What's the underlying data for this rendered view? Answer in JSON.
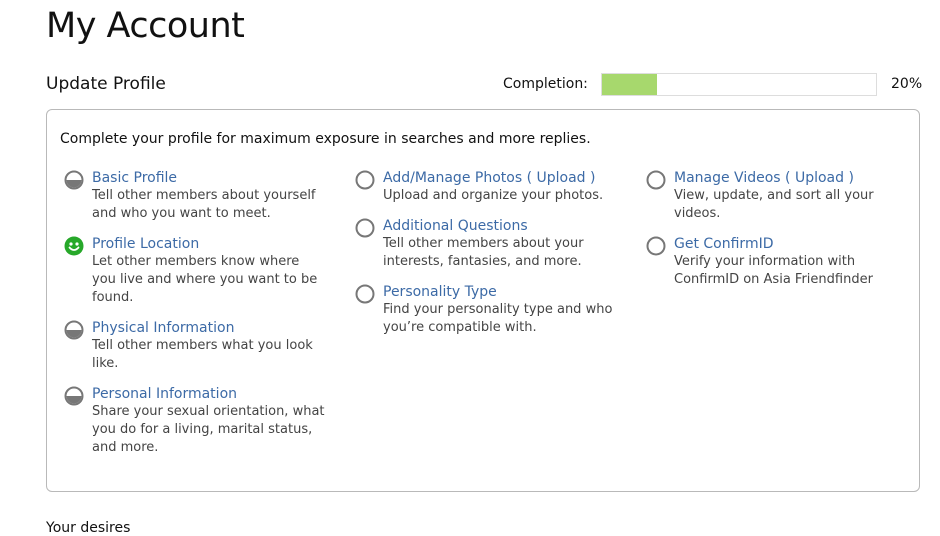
{
  "page": {
    "title": "My Account"
  },
  "profile": {
    "section_title": "Update Profile",
    "completion_label": "Completion:",
    "completion_percent": "20%",
    "completion_fraction": 0.2,
    "progress_color": "#a7d86d",
    "intro": "Complete your profile for maximum exposure in searches and more replies.",
    "columns": [
      [
        {
          "title": "Basic Profile",
          "desc": "Tell other members about yourself and who you want to meet.",
          "status_icon": "half-complete-icon"
        },
        {
          "title": "Profile Location",
          "desc": "Let other members know where you live and where you want to be found.",
          "status_icon": "smiley-complete-icon"
        },
        {
          "title": "Physical Information",
          "desc": "Tell other members what you look like.",
          "status_icon": "half-complete-icon"
        },
        {
          "title": "Personal Information",
          "desc": "Share your sexual orientation, what you do for a living, marital status, and more.",
          "status_icon": "half-complete-icon"
        }
      ],
      [
        {
          "title": "Add/Manage Photos",
          "open_paren": "(",
          "upload": "Upload",
          "close_paren": ")",
          "desc": "Upload and organize your photos.",
          "status_icon": "empty-circle-icon"
        },
        {
          "title": "Additional Questions",
          "desc": "Tell other members about your interests, fantasies, and more.",
          "status_icon": "empty-circle-icon"
        },
        {
          "title": "Personality Type",
          "desc": "Find your personality type and who you’re compatible with.",
          "status_icon": "empty-circle-icon"
        }
      ],
      [
        {
          "title": "Manage Videos",
          "open_paren": "(",
          "upload": "Upload",
          "close_paren": ")",
          "desc": "View, update, and sort all your videos.",
          "status_icon": "empty-circle-icon"
        },
        {
          "title": "Get ConfirmID",
          "desc": "Verify your information with ConfirmID on Asia Friendfinder",
          "status_icon": "empty-circle-icon"
        }
      ]
    ]
  },
  "next_section": {
    "title": "Your desires"
  }
}
